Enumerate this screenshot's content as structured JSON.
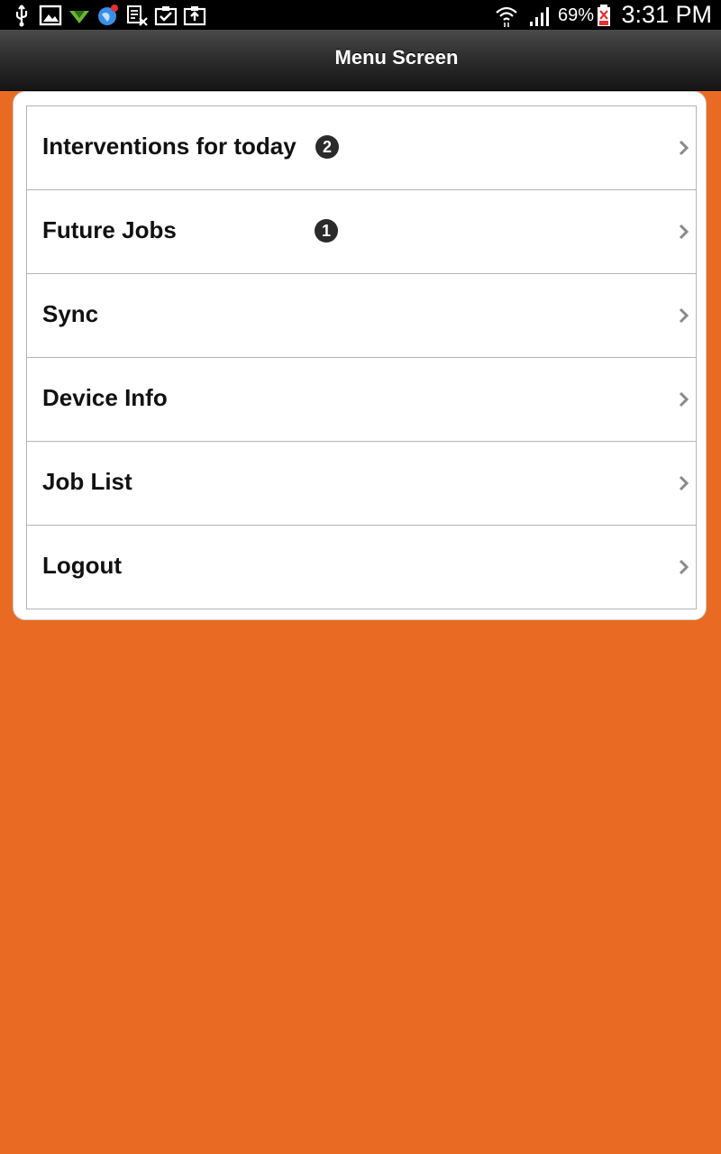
{
  "status_bar": {
    "battery_percent": "69%",
    "time": "3:31 PM",
    "icons": [
      "usb-icon",
      "image-icon",
      "download-icon",
      "globe-notification-icon",
      "sim-error-icon",
      "clipboard-check-icon",
      "clipboard-upload-icon",
      "wifi-icon",
      "signal-icon",
      "battery-icon"
    ]
  },
  "header": {
    "title": "Menu Screen"
  },
  "menu": {
    "items": [
      {
        "label": "Interventions for today",
        "badge": "2"
      },
      {
        "label": "Future Jobs",
        "badge": "1"
      },
      {
        "label": "Sync"
      },
      {
        "label": "Device Info"
      },
      {
        "label": "Job List"
      },
      {
        "label": "Logout"
      }
    ]
  },
  "colors": {
    "background": "#e96b23",
    "header": "#2e2e2e",
    "badge": "#2b2b2b"
  }
}
